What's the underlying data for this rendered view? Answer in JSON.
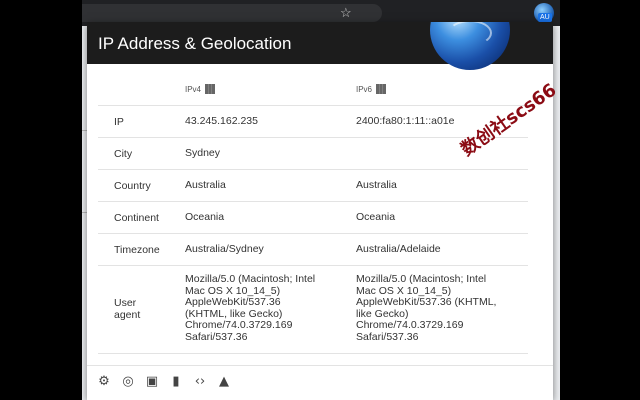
{
  "popup": {
    "title": "IP Address & Geolocation",
    "columns": {
      "ipv4": "IPv4",
      "ipv6": "IPv6"
    },
    "rows": [
      {
        "label": "IP",
        "ipv4": "43.245.162.235",
        "ipv6": "2400:fa80:1:11::a01e"
      },
      {
        "label": "City",
        "ipv4": "Sydney",
        "ipv6": ""
      },
      {
        "label": "Country",
        "ipv4": "Australia",
        "ipv6": "Australia"
      },
      {
        "label": "Continent",
        "ipv4": "Oceania",
        "ipv6": "Oceania"
      },
      {
        "label": "Timezone",
        "ipv4": "Australia/Sydney",
        "ipv6": "Australia/Adelaide"
      },
      {
        "label": "User agent",
        "ipv4": "Mozilla/5.0 (Macintosh; Intel Mac OS X 10_14_5) AppleWebKit/537.36 (KHTML, like Gecko) Chrome/74.0.3729.169 Safari/537.36",
        "ipv6": "Mozilla/5.0 (Macintosh; Intel Mac OS X 10_14_5) AppleWebKit/537.36 (KHTML, like Gecko) Chrome/74.0.3729.169 Safari/537.36"
      }
    ],
    "footer_icons": [
      "gear-icon",
      "fingerprint-icon",
      "search-doc-icon",
      "bar-chart-icon",
      "code-icon",
      "android-icon"
    ]
  },
  "extension": {
    "badge": "AU"
  },
  "watermark": "数创社scs66",
  "colors": {
    "header_bg": "#1c1c1c",
    "watermark": "#8b0b14"
  }
}
